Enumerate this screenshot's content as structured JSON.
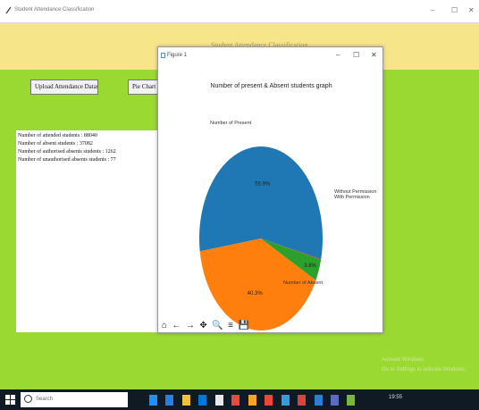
{
  "window": {
    "title": "Student Attendance Classification",
    "min": "–",
    "max": "☐",
    "close": "✕"
  },
  "banner": {
    "heading": "Student Attendance Classification"
  },
  "buttons": {
    "upload": "Upload Attendance Dataset",
    "pie": "Pie Chart Graph"
  },
  "stats": [
    "Number of attended students : 88040",
    "Number of absent students : 37082",
    "Number of authorised absents students : 1262",
    "Number of unauthorised absents students : 77"
  ],
  "figure": {
    "title": "Figure 1",
    "min": "–",
    "max": "☐",
    "close": "✕",
    "toolbar": [
      "⌂",
      "←",
      "→",
      "✥",
      "🔍",
      "≡",
      "💾"
    ]
  },
  "chart_data": {
    "type": "pie",
    "title": "Number of present & Absent students graph",
    "slices": [
      {
        "label": "Number of Present",
        "value": 55.9,
        "pct_label": "55.9%",
        "color": "#1f77b4"
      },
      {
        "label": "Number of Absent",
        "value": 40.3,
        "pct_label": "40.3%",
        "color": "#ff7f0e"
      },
      {
        "label": "Without Permission",
        "value": 3.8,
        "pct_label": "3.8%",
        "color": "#2ca02c"
      },
      {
        "label": "With Permission",
        "value": 0.1,
        "pct_label": "",
        "color": "#d62728"
      }
    ]
  },
  "watermark": [
    "Activate Windows",
    "Go to Settings to activate Windows."
  ],
  "taskbar": {
    "search": "Search",
    "clock": "19:55"
  }
}
